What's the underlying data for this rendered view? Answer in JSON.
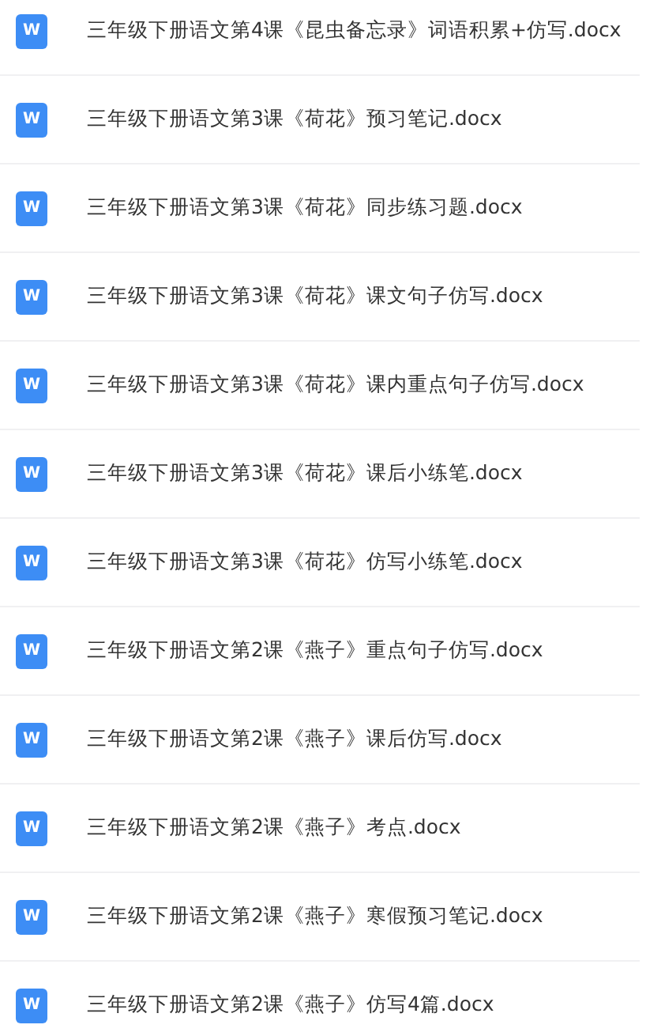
{
  "files": [
    {
      "icon_letter": "W",
      "name": "三年级下册语文第4课《昆虫备忘录》词语积累+仿写.docx"
    },
    {
      "icon_letter": "W",
      "name": "三年级下册语文第3课《荷花》预习笔记.docx"
    },
    {
      "icon_letter": "W",
      "name": "三年级下册语文第3课《荷花》同步练习题.docx"
    },
    {
      "icon_letter": "W",
      "name": "三年级下册语文第3课《荷花》课文句子仿写.docx"
    },
    {
      "icon_letter": "W",
      "name": "三年级下册语文第3课《荷花》课内重点句子仿写.docx"
    },
    {
      "icon_letter": "W",
      "name": "三年级下册语文第3课《荷花》课后小练笔.docx"
    },
    {
      "icon_letter": "W",
      "name": "三年级下册语文第3课《荷花》仿写小练笔.docx"
    },
    {
      "icon_letter": "W",
      "name": "三年级下册语文第2课《燕子》重点句子仿写.docx"
    },
    {
      "icon_letter": "W",
      "name": "三年级下册语文第2课《燕子》课后仿写.docx"
    },
    {
      "icon_letter": "W",
      "name": "三年级下册语文第2课《燕子》考点.docx"
    },
    {
      "icon_letter": "W",
      "name": "三年级下册语文第2课《燕子》寒假预习笔记.docx"
    },
    {
      "icon_letter": "W",
      "name": "三年级下册语文第2课《燕子》仿写4篇.docx"
    }
  ]
}
